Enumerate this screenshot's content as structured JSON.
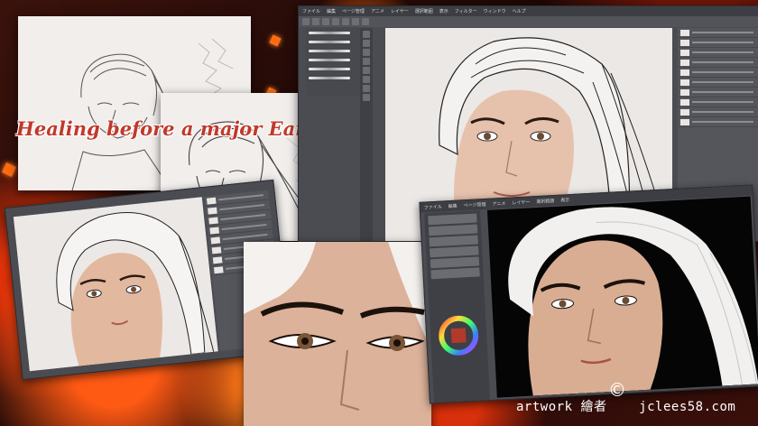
{
  "headline": "Healing before a major Earthquake…",
  "credit": {
    "artwork_label": "artwork",
    "cjk_label": "繪者",
    "site": "jclees58.com",
    "copyright_symbol": "©"
  },
  "app_window": {
    "menu_items": [
      "ファイル",
      "編集",
      "ページ管理",
      "アニメ",
      "レイヤー",
      "選択範囲",
      "表示",
      "フィルター",
      "ウィンドウ",
      "ヘルプ"
    ]
  },
  "colors": {
    "headline": "#c0392b",
    "background": "#2a0d0a",
    "app_chrome": "#4a4c52",
    "canvas_light": "#ece8e6",
    "canvas_dark": "#050505"
  }
}
